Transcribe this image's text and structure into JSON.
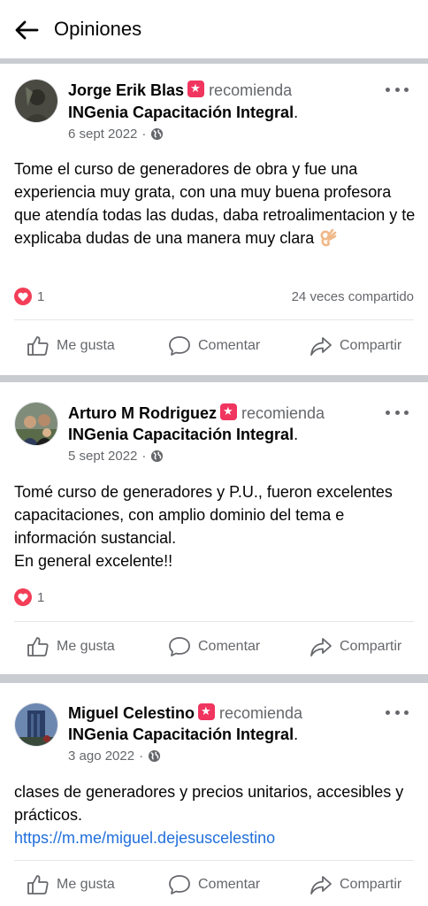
{
  "header": {
    "title": "Opiniones"
  },
  "rec_word": "recomienda",
  "page_name": "INGenia Capacitación Integral",
  "page_dot": ".",
  "actions": {
    "like": "Me gusta",
    "comment": "Comentar",
    "share": "Compartir"
  },
  "posts": [
    {
      "author": "Jorge Erik Blas",
      "date": "6 sept 2022",
      "text": [
        "Tome el curso de generadores de obra y fue una experiencia muy grata, con una muy buena profesora que atendía todas las dudas, daba retroalimentacion y te explicaba dudas de una manera muy clara"
      ],
      "emoji": "ok-hand-emoji",
      "reactions": "1",
      "shares": "24 veces compartido"
    },
    {
      "author": "Arturo M Rodriguez",
      "date": "5 sept 2022",
      "text": [
        "Tomé curso de generadores y P.U., fueron excelentes capacitaciones, con amplio dominio del tema e información sustancial.",
        "En general excelente!!"
      ],
      "reactions": "1"
    },
    {
      "author": "Miguel Celestino",
      "date": "3 ago 2022",
      "text": [
        "clases de generadores y precios unitarios, accesibles y prácticos."
      ],
      "link": "https://m.me/miguel.dejesuscelestino"
    }
  ],
  "colors": {
    "reaction_heart": "#f33e58",
    "recommend_badge": "#f0355f",
    "link": "#216fdb",
    "divider": "#c9ccd1",
    "secondary_text": "#65676b"
  }
}
